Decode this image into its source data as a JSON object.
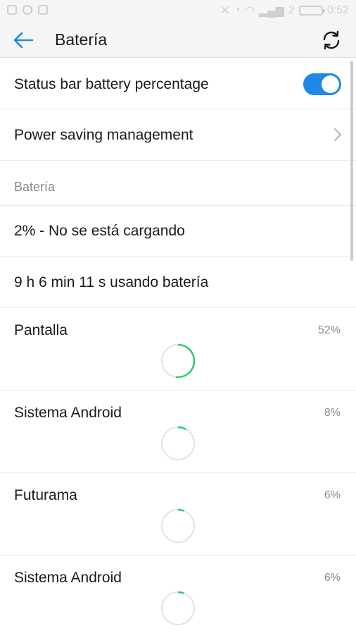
{
  "status_bar": {
    "signal_label": "2",
    "time": "0:52"
  },
  "header": {
    "title": "Batería"
  },
  "settings": {
    "battery_percentage_label": "Status bar battery percentage",
    "battery_percentage_enabled": true,
    "power_saving_label": "Power saving management"
  },
  "battery_section": {
    "title": "Batería",
    "status": "2% - No se está cargando",
    "usage_time": "9 h 6 min 11 s usando batería"
  },
  "apps": [
    {
      "name": "Pantalla",
      "percent_label": "52%",
      "percent": 52
    },
    {
      "name": "Sistema Android",
      "percent_label": "8%",
      "percent": 8
    },
    {
      "name": "Futurama",
      "percent_label": "6%",
      "percent": 6
    },
    {
      "name": "Sistema Android",
      "percent_label": "6%",
      "percent": 6
    }
  ],
  "colors": {
    "accent": "#1e88e5",
    "ring_fill": "#2ecc71",
    "ring_track": "#e3e3e3"
  },
  "icons": {
    "back": "arrow-left-icon",
    "refresh": "refresh-icon",
    "chevron": "chevron-right-icon"
  }
}
